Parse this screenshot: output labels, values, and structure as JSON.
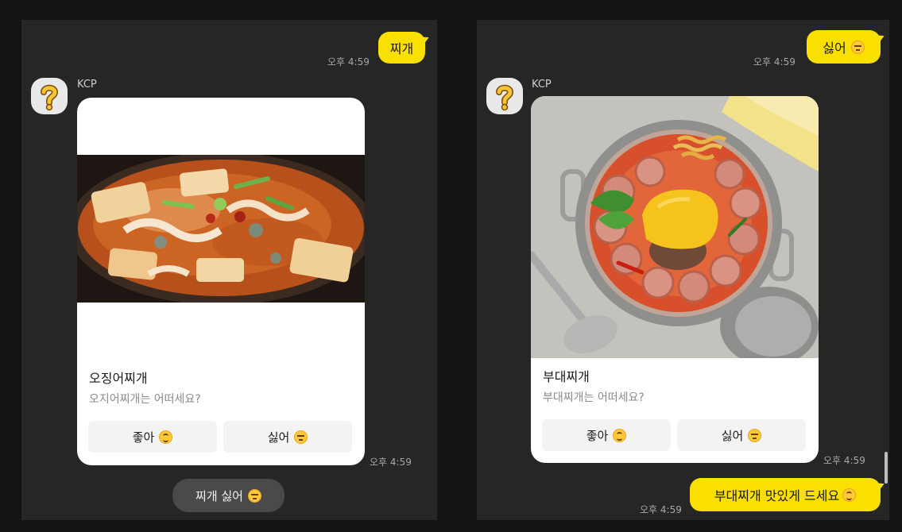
{
  "left": {
    "user_message": "찌개",
    "user_time": "오후 4:59",
    "bot_name": "KCP",
    "card": {
      "title": "오징어찌개",
      "description": "오지어찌개는 어떠세요?",
      "like_label": "좋아",
      "dislike_label": "싫어"
    },
    "card_time": "오후 4:59",
    "quick_reply": "찌개 싫어"
  },
  "right": {
    "user_message": "싫어",
    "user_time": "오후 4:59",
    "bot_name": "KCP",
    "card": {
      "title": "부대찌개",
      "description": "부대찌개는 어떠세요?",
      "like_label": "좋아",
      "dislike_label": "싫어"
    },
    "card_time": "오후 4:59",
    "user_reply": "부대찌개 맛있게 드세요",
    "user_reply_time": "오후 4:59"
  },
  "icons": {
    "avatar": "question-mark-icon",
    "like": "smiling-face-icon",
    "dislike": "unamused-face-icon",
    "quick_reply": "expressionless-face-icon",
    "reply": "grinning-face-icon"
  },
  "colors": {
    "user_bubble": "#f9e000",
    "panel": "#262626",
    "background": "#141414",
    "card": "#ffffff"
  }
}
